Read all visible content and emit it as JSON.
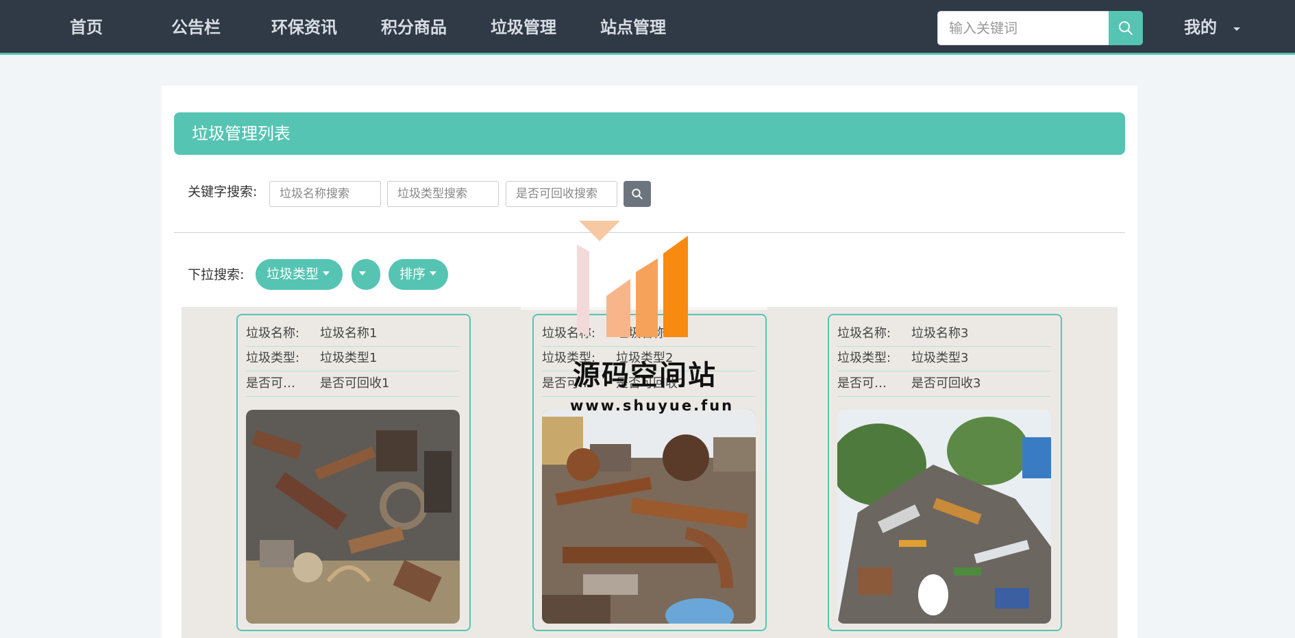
{
  "nav": {
    "items": [
      "首页",
      "公告栏",
      "环保资讯",
      "积分商品",
      "垃圾管理",
      "站点管理"
    ],
    "search_placeholder": "输入关键词",
    "mine_label": "我的"
  },
  "page": {
    "title": "垃圾管理列表",
    "keyword_label": "关键字搜索:",
    "keyword_inputs": [
      "垃圾名称搜索",
      "垃圾类型搜索",
      "是否可回收搜索"
    ],
    "dropdown_label": "下拉搜索:",
    "dropdowns": [
      "垃圾类型",
      "",
      "排序"
    ]
  },
  "cards": [
    {
      "rows": [
        {
          "key": "垃圾名称:",
          "value": "垃圾名称1"
        },
        {
          "key": "垃圾类型:",
          "value": "垃圾类型1"
        },
        {
          "key": "是否可…",
          "value": "是否可回收1"
        }
      ]
    },
    {
      "rows": [
        {
          "key": "垃圾名称:",
          "value": "垃圾名称2"
        },
        {
          "key": "垃圾类型:",
          "value": "垃圾类型2"
        },
        {
          "key": "是否可…",
          "value": "是否可回收2"
        }
      ]
    },
    {
      "rows": [
        {
          "key": "垃圾名称:",
          "value": "垃圾名称3"
        },
        {
          "key": "垃圾类型:",
          "value": "垃圾类型3"
        },
        {
          "key": "是否可…",
          "value": "是否可回收3"
        }
      ]
    }
  ],
  "watermark": {
    "title": "源码空间站",
    "url": "www.shuyue.fun"
  },
  "colors": {
    "navbar": "#2f3a46",
    "accent": "#56c4b2",
    "card_bg": "#ece9e4",
    "search_button_gray": "#6c757d"
  },
  "icons": {
    "nav_search": "search-icon",
    "keyword_search": "search-icon",
    "mine_dropdown": "caret-down-icon"
  }
}
